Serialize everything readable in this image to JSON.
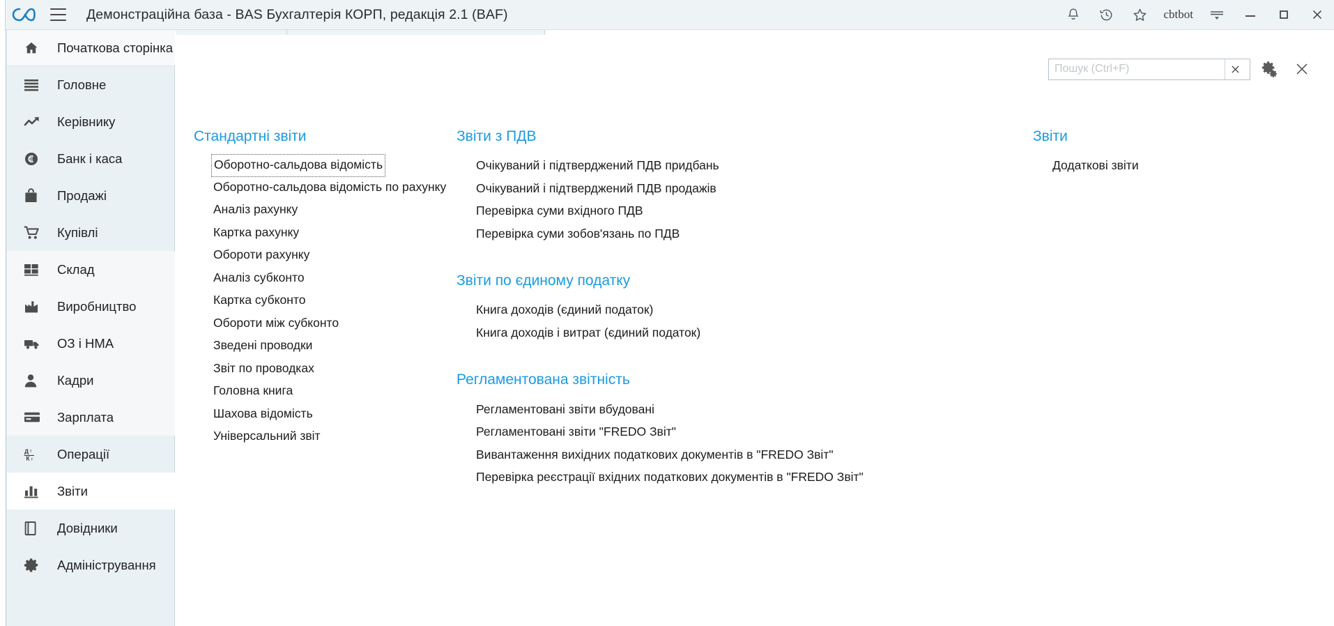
{
  "titlebar": {
    "logo_icon": "infinity-logo-icon",
    "menu_icon": "hamburger-menu-icon",
    "title": "Демонстраційна база - BAS Бухгалтерія КОРП, редакція 2.1  (BAF)",
    "notifications_icon": "bell-icon",
    "history_icon": "history-clock-icon",
    "favorites_icon": "star-icon",
    "user_label": "cbtbot",
    "more_icon": "menu-more-icon",
    "minimize_icon": "minimize-icon",
    "maximize_icon": "maximize-icon",
    "close_icon": "close-icon",
    "accent_color": "#1a9be0",
    "bar_color": "#eef3f6"
  },
  "sidebar": {
    "items": [
      {
        "label": "Початкова сторінка",
        "icon": "home-icon",
        "state": "home"
      },
      {
        "label": "Головне",
        "icon": "list-lines-icon",
        "state": "normal"
      },
      {
        "label": "Керівнику",
        "icon": "trend-up-icon",
        "state": "normal"
      },
      {
        "label": "Банк і каса",
        "icon": "coin-icon",
        "state": "normal"
      },
      {
        "label": "Продажі",
        "icon": "shopping-bag-icon",
        "state": "normal"
      },
      {
        "label": "Купівлі",
        "icon": "shopping-cart-icon",
        "state": "normal"
      },
      {
        "label": "Склад",
        "icon": "warehouse-grid-icon",
        "state": "normal"
      },
      {
        "label": "Виробництво",
        "icon": "factory-icon",
        "state": "normal"
      },
      {
        "label": "ОЗ і НМА",
        "icon": "truck-icon",
        "state": "normal"
      },
      {
        "label": "Кадри",
        "icon": "person-icon",
        "state": "normal"
      },
      {
        "label": "Зарплата",
        "icon": "card-icon",
        "state": "normal"
      },
      {
        "label": "Операції",
        "icon": "debit-credit-icon",
        "state": "normal"
      },
      {
        "label": "Звіти",
        "icon": "bar-chart-icon",
        "state": "selected"
      },
      {
        "label": "Довідники",
        "icon": "book-icon",
        "state": "normal"
      },
      {
        "label": "Адміністрування",
        "icon": "gear-icon",
        "state": "normal"
      }
    ]
  },
  "toolbar": {
    "search_placeholder": "Пошук (Ctrl+F)",
    "search_value": "",
    "clear_icon": "clear-x-icon",
    "settings_icon": "gear-settings-icon",
    "close_icon": "close-panel-icon"
  },
  "columns": [
    {
      "name": "column-standard-reports",
      "groups": [
        {
          "title": "Стандартні звіти",
          "items": [
            {
              "label": "Оборотно-сальдова відомість",
              "focused": true
            },
            {
              "label": "Оборотно-сальдова відомість по рахунку",
              "focused": false
            },
            {
              "label": "Аналіз рахунку",
              "focused": false
            },
            {
              "label": "Картка рахунку",
              "focused": false
            },
            {
              "label": "Обороти рахунку",
              "focused": false
            },
            {
              "label": "Аналіз субконто",
              "focused": false
            },
            {
              "label": "Картка субконто",
              "focused": false
            },
            {
              "label": "Обороти між субконто",
              "focused": false
            },
            {
              "label": "Зведені проводки",
              "focused": false
            },
            {
              "label": "Звіт по проводках",
              "focused": false
            },
            {
              "label": "Головна книга",
              "focused": false
            },
            {
              "label": "Шахова відомість",
              "focused": false
            },
            {
              "label": "Універсальний звіт",
              "focused": false
            }
          ]
        }
      ]
    },
    {
      "name": "column-vat-and-regulated",
      "groups": [
        {
          "title": "Звіти з ПДВ",
          "items": [
            {
              "label": "Очікуваний і підтверджений ПДВ придбань",
              "focused": false
            },
            {
              "label": "Очікуваний і підтверджений ПДВ продажів",
              "focused": false
            },
            {
              "label": "Перевірка суми вхідного ПДВ",
              "focused": false
            },
            {
              "label": "Перевірка суми зобов'язань по ПДВ",
              "focused": false
            }
          ]
        },
        {
          "title": "Звіти по єдиному податку",
          "items": [
            {
              "label": "Книга доходів (єдиний податок)",
              "focused": false
            },
            {
              "label": "Книга доходів і витрат (єдиний податок)",
              "focused": false
            }
          ]
        },
        {
          "title": "Регламентована звітність",
          "items": [
            {
              "label": "Регламентовані звіти вбудовані",
              "focused": false
            },
            {
              "label": "Регламентовані звіти \"FREDO Звіт\"",
              "focused": false
            },
            {
              "label": "Вивантаження вихідних податкових документів в \"FREDO Звіт\"",
              "focused": false
            },
            {
              "label": "Перевірка реєстрації вхідних податкових документів в \"FREDO Звіт\"",
              "focused": false
            }
          ]
        }
      ]
    },
    {
      "name": "column-reports",
      "groups": [
        {
          "title": "Звіти",
          "items": [
            {
              "label": "Додаткові звіти",
              "focused": false
            }
          ]
        }
      ]
    }
  ]
}
